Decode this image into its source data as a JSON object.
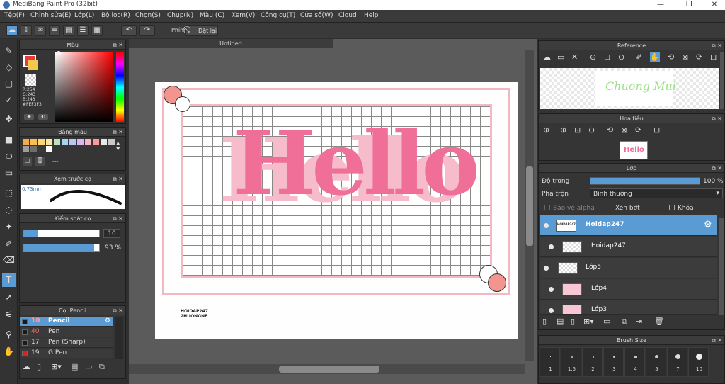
{
  "window": {
    "title": "MediBang Paint Pro (32bit)",
    "minimize": "—",
    "maximize": "❐",
    "close": "✕"
  },
  "menu": [
    "Tệp(F)",
    "Chỉnh sửa(E)",
    "Lớp(L)",
    "Bộ lọc(R)",
    "Chọn(S)",
    "Chụp(N)",
    "Màu (C)",
    "Xem(V)",
    "Công cụ(T)",
    "Cửa sổ(W)",
    "Cloud",
    "Help"
  ],
  "toolbar": {
    "shortcut_label": "Phím",
    "reset_label": "Đặt lại"
  },
  "color_panel": {
    "title": "Màu",
    "r": "R:254",
    "g": "G:243",
    "b": "B:243",
    "hex": "#FEF3F3",
    "primary": "#e83a3a",
    "secondary": "#f2c94c"
  },
  "palette_panel": {
    "title": "Bảng màu",
    "swatches": [
      "#f7a94c",
      "#f6c14f",
      "#f9d87a",
      "#fbe6a5",
      "#b9e2c3",
      "#a3d6f0",
      "#b5c7f2",
      "#d7b8f0",
      "#f7b4c9",
      "#f99a9a",
      "#e8e8e8",
      "#c9c9c9",
      "#9e9e9e",
      "#6e6e6e",
      "#3a3a3a",
      "#ffffff"
    ],
    "dash": "---"
  },
  "preview_panel": {
    "title": "Xem trước cọ",
    "size": "0.73mm"
  },
  "control_panel": {
    "title": "Kiểm soát cọ",
    "size_value": "10",
    "opacity_value": "93 %"
  },
  "brush_panel": {
    "title": "Cọ: Pencil",
    "brushes": [
      {
        "size": "10",
        "name": "Pencil",
        "color": "#1a1a1a"
      },
      {
        "size": "40",
        "name": "Pen",
        "color": "#1a1a1a"
      },
      {
        "size": "17",
        "name": "Pen (Sharp)",
        "color": "#1a1a1a"
      },
      {
        "size": "19",
        "name": "G Pen",
        "color": "#e02020"
      }
    ]
  },
  "document": {
    "title": "Untitled",
    "credit_line1": "HOIDAP247",
    "credit_line2": "2HUONGNE",
    "art_text": "Hello"
  },
  "reference_panel": {
    "title": "Reference",
    "preview_text": "Chuong Mui"
  },
  "navigator_panel": {
    "title": "Hoa tiêu",
    "thumb_text": "Hello"
  },
  "layer_panel": {
    "title": "Lớp",
    "opacity_label": "Độ trong",
    "opacity_value": "100 %",
    "opacity_fraction": 1.0,
    "blend_label": "Pha trộn",
    "blend_value": "Bình thường",
    "protect_alpha": "Bảo vệ alpha",
    "clip": "Xén bớt",
    "lock": "Khóa",
    "layers": [
      {
        "name": "Hoidap247",
        "selected": true,
        "thumb_text": "HOIDAP247"
      },
      {
        "name": "Hoidap247",
        "selected": false,
        "thumb_text": ""
      },
      {
        "name": "Lớp5",
        "selected": false,
        "thumb_text": ""
      },
      {
        "name": "Lớp4",
        "selected": false,
        "thumb_text": ""
      },
      {
        "name": "Lớp3",
        "selected": false,
        "thumb_text": ""
      }
    ]
  },
  "brush_size_panel": {
    "title": "Brush Size",
    "sizes": [
      "1",
      "1.5",
      "2",
      "3",
      "4",
      "5",
      "7",
      "10"
    ]
  }
}
